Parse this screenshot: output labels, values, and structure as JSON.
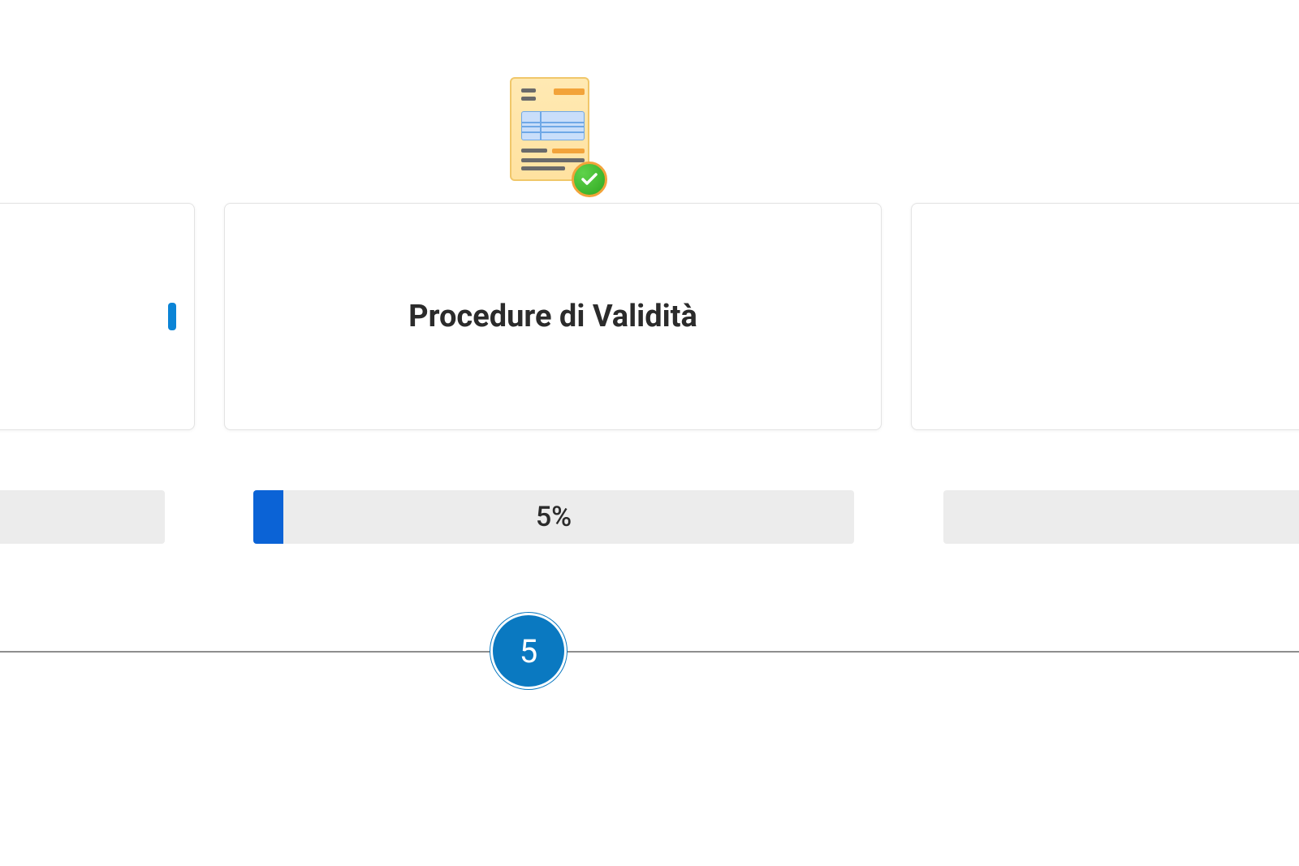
{
  "icon": {
    "name": "validated-document-icon"
  },
  "cards": {
    "left": {
      "title": ""
    },
    "center": {
      "title": "Procedure di Validità"
    },
    "right": {
      "title": ""
    }
  },
  "progress": {
    "center": {
      "percent": 5,
      "label": "5%"
    }
  },
  "stepper": {
    "current": "5"
  }
}
